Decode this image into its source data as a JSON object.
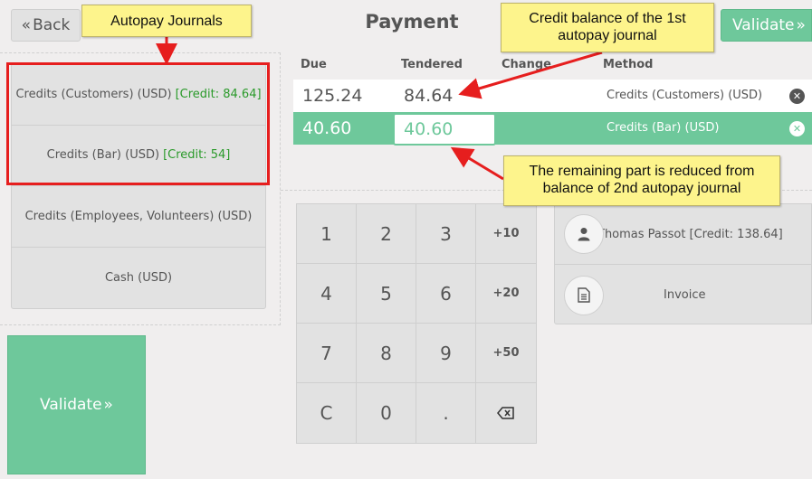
{
  "header": {
    "back_label": "Back",
    "title": "Payment",
    "validate_label": "Validate"
  },
  "journals": [
    {
      "name": "Credits (Customers) (USD)",
      "credit": "[Credit: 84.64]"
    },
    {
      "name": "Credits (Bar) (USD)",
      "credit": "[Credit: 54]"
    },
    {
      "name": "Credits (Employees, Volunteers) (USD)",
      "credit": ""
    },
    {
      "name": "Cash (USD)",
      "credit": ""
    }
  ],
  "validate_big_label": "Validate",
  "lines": {
    "headers": {
      "due": "Due",
      "tendered": "Tendered",
      "change": "Change",
      "method": "Method"
    },
    "rows": [
      {
        "due": "125.24",
        "tendered": "84.64",
        "method": "Credits (Customers) (USD)",
        "selected": false
      },
      {
        "due": "40.60",
        "tendered": "40.60",
        "method": "Credits (Bar) (USD)",
        "selected": true
      }
    ]
  },
  "numpad": [
    "1",
    "2",
    "3",
    "+10",
    "4",
    "5",
    "6",
    "+20",
    "7",
    "8",
    "9",
    "+50",
    "C",
    "0",
    ".",
    "backspace"
  ],
  "customer": {
    "name": "Thomas Passot",
    "credit": "[Credit: 138.64]",
    "invoice_label": "Invoice"
  },
  "annotations": {
    "autopay": "Autopay Journals",
    "credit_balance": "Credit balance of the 1st autopay journal",
    "remaining": "The remaining part is reduced from balance of 2nd autopay journal"
  },
  "colors": {
    "accent_green": "#6ec89b",
    "credit_text": "#2a9a2a",
    "annotation_red": "#e61e1e",
    "note_yellow": "#fdf48c"
  }
}
